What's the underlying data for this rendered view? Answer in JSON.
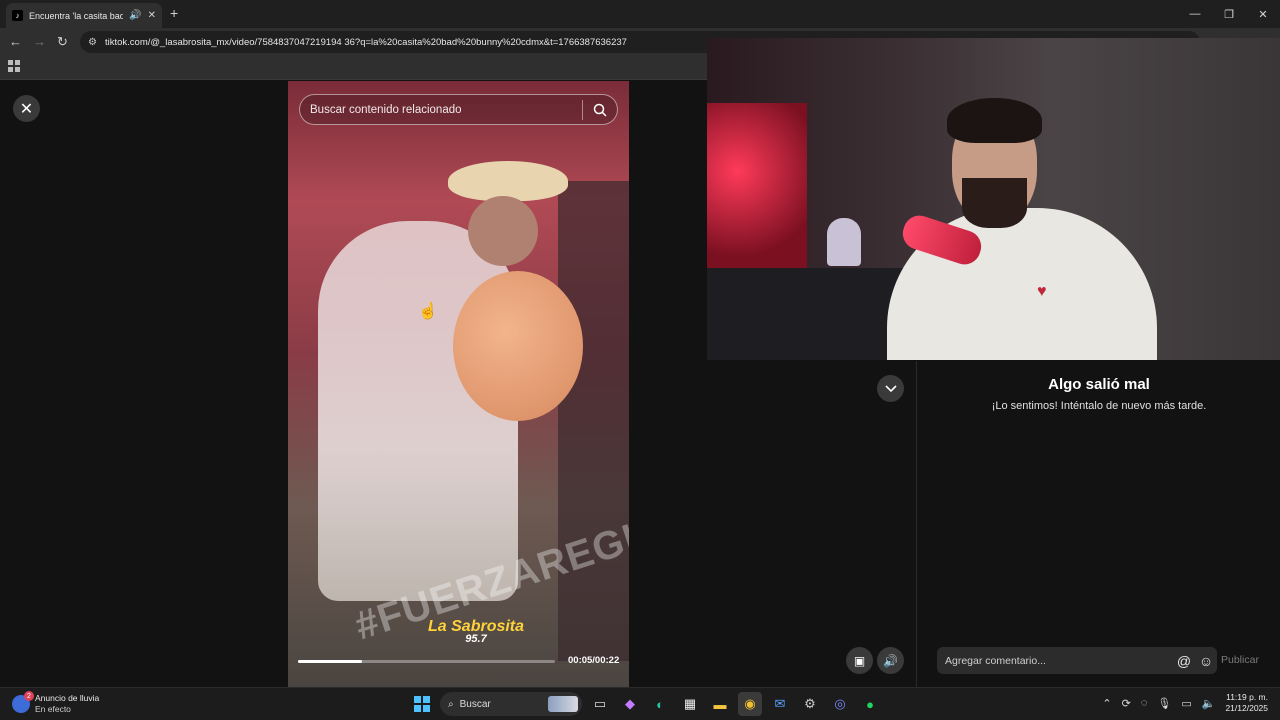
{
  "browser": {
    "tab_title": "Encuentra 'la casita bad bu",
    "tab_favicon": "tiktok-icon",
    "url": "tiktok.com/@_lasabrosita_mx/video/7584837047219194 36?q=la%20casita%20bad%20bunny%20cdmx&t=1766387636237"
  },
  "video": {
    "search_placeholder": "Buscar contenido relacionado",
    "watermark_text": "#FUERZAREGIDA",
    "logo_text": "La Sabrosita",
    "logo_freq": "95.7",
    "time_display": "00:05/00:22",
    "progress_fraction": 0.25
  },
  "panel": {
    "error_title": "Algo salió mal",
    "error_subtitle": "¡Lo sentimos! Inténtalo de nuevo más tarde.",
    "comment_placeholder": "Agregar comentario...",
    "publish_label": "Publicar"
  },
  "taskbar": {
    "weather_title": "Anuncio de lluvia",
    "weather_sub": "En efecto",
    "weather_badge": "2",
    "search_label": "Buscar",
    "time": "11:19 p. m.",
    "date": "21/12/2025"
  },
  "colors": {
    "accent": "#4cc2ff",
    "page_bg": "#121212",
    "publish_disabled": "#7a7a7a"
  }
}
